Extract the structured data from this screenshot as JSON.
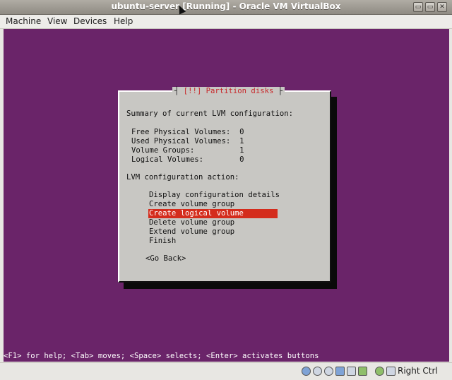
{
  "window": {
    "title": "ubuntu-server [Running] - Oracle VM VirtualBox",
    "minimize_glyph": "▭",
    "maximize_glyph": "▭",
    "close_glyph": "✕"
  },
  "menubar": {
    "items": [
      {
        "label": "Machine"
      },
      {
        "label": "View"
      },
      {
        "label": "Devices"
      },
      {
        "label": "Help"
      }
    ]
  },
  "dialog": {
    "title": "[!!] Partition disks",
    "summary_heading": "Summary of current LVM configuration:",
    "summary": [
      {
        "text": "Free Physical Volumes:  0"
      },
      {
        "text": "Used Physical Volumes:  1"
      },
      {
        "text": "Volume Groups:          1"
      },
      {
        "text": "Logical Volumes:        0"
      }
    ],
    "action_heading": "LVM configuration action:",
    "actions": [
      {
        "label": "Display configuration details"
      },
      {
        "label": "Create volume group"
      },
      {
        "label": "Create logical volume"
      },
      {
        "label": "Delete volume group"
      },
      {
        "label": "Extend volume group"
      },
      {
        "label": "Finish"
      }
    ],
    "selected_action": "Create logical volume",
    "back_button": "<Go Back>"
  },
  "helpbar": {
    "text": "<F1> for help; <Tab> moves; <Space> selects; <Enter> activates buttons"
  },
  "statusbar": {
    "host_key": "Right Ctrl",
    "icons": [
      "hard-disk-icon",
      "optical-drive-icon",
      "usb-icon",
      "shared-folders-icon",
      "network-icon",
      "display-icon",
      "virtualization-icon",
      "mouse-integration-icon"
    ]
  },
  "colors": {
    "console_bg": "#6a2469",
    "dialog_bg": "#c8c7c3",
    "selection": "#d42c1c",
    "dialog_title": "#c8282a"
  }
}
